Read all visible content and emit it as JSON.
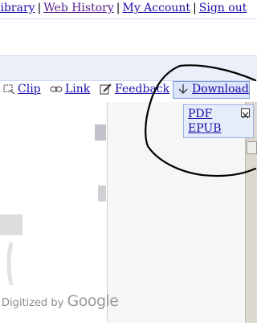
{
  "top_links": {
    "library": "library",
    "web_history": "Web History",
    "my_account": "My Account",
    "sign_out": "Sign out",
    "separator": "|"
  },
  "toolbar": {
    "clip": "Clip",
    "link": "Link",
    "feedback": "Feedback",
    "download": "Download"
  },
  "download_menu": {
    "items": [
      "PDF",
      "EPUB"
    ],
    "close_icon": "close-icon"
  },
  "watermark": {
    "prefix": "Digitized by",
    "brand": "Google"
  },
  "colors": {
    "link": "#1a0dab",
    "visited_link": "#551a8b",
    "band": "#ebeff9",
    "menu_bg": "#e6ecfa",
    "annotation": "#000000"
  }
}
